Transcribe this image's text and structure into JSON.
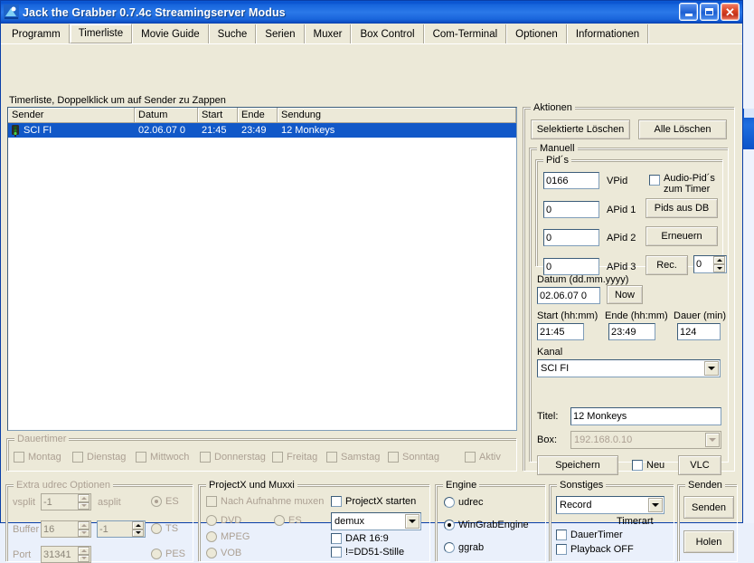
{
  "window": {
    "title": "Jack the Grabber 0.7.4c Streamingserver Modus",
    "icon": "app-icon",
    "buttons": {
      "minimize": "minimize",
      "maximize": "maximize",
      "close": "close"
    }
  },
  "tabs": [
    {
      "label": "Programm",
      "selected": false
    },
    {
      "label": "Timerliste",
      "selected": true
    },
    {
      "label": "Movie Guide",
      "selected": false
    },
    {
      "label": "Suche",
      "selected": false
    },
    {
      "label": "Serien",
      "selected": false
    },
    {
      "label": "Muxer",
      "selected": false
    },
    {
      "label": "Box Control",
      "selected": false
    },
    {
      "label": "Com-Terminal",
      "selected": false
    },
    {
      "label": "Optionen",
      "selected": false
    },
    {
      "label": "Informationen",
      "selected": false
    }
  ],
  "timerlist": {
    "hint": "Timerliste, Doppelklick um auf Sender zu Zappen",
    "columns": [
      "Sender",
      "Datum",
      "Start",
      "Ende",
      "Sendung"
    ],
    "rows": [
      {
        "icon": "traffic-light-icon",
        "sender": "SCI FI",
        "datum": "02.06.07 0",
        "start": "21:45",
        "ende": "23:49",
        "sendung": "12 Monkeys",
        "selected": true
      }
    ]
  },
  "dauertimer": {
    "caption": "Dauertimer",
    "days": [
      {
        "label": "Montag",
        "checked": false,
        "disabled": true
      },
      {
        "label": "Dienstag",
        "checked": false,
        "disabled": true
      },
      {
        "label": "Mittwoch",
        "checked": false,
        "disabled": true
      },
      {
        "label": "Donnerstag",
        "checked": false,
        "disabled": true
      },
      {
        "label": "Freitag",
        "checked": false,
        "disabled": true
      },
      {
        "label": "Samstag",
        "checked": false,
        "disabled": true
      },
      {
        "label": "Sonntag",
        "checked": false,
        "disabled": true
      }
    ],
    "aktiv": {
      "label": "Aktiv",
      "checked": false,
      "disabled": true
    }
  },
  "aktionen": {
    "caption": "Aktionen",
    "delete_selected": "Selektierte Löschen",
    "delete_all": "Alle Löschen",
    "manuell": {
      "caption": "Manuell",
      "pids": {
        "caption": "Pid´s",
        "vpid": {
          "label": "VPid",
          "value": "0166"
        },
        "apid1": {
          "label": "APid 1",
          "value": "0"
        },
        "apid2": {
          "label": "APid 2",
          "value": "0"
        },
        "apid3": {
          "label": "APid 3",
          "value": "0"
        },
        "audio_pids_checkbox": {
          "label_line1": "Audio-Pid´s",
          "label_line2": "zum Timer",
          "checked": false
        },
        "pids_from_db": "Pids aus DB",
        "renew": "Erneuern",
        "rec": "Rec.",
        "rec_count": "0"
      },
      "datum": {
        "label": "Datum (dd.mm.yyyy)",
        "value": "02.06.07 0",
        "now_button": "Now"
      },
      "start": {
        "label": "Start (hh:mm)",
        "value": "21:45"
      },
      "ende": {
        "label": "Ende (hh:mm)",
        "value": "23:49"
      },
      "dauer": {
        "label": "Dauer (min)",
        "value": "124"
      },
      "kanal": {
        "label": "Kanal",
        "value": "SCI FI"
      },
      "titel": {
        "label": "Titel:",
        "value": "12 Monkeys"
      },
      "box": {
        "label": "Box:",
        "value": "192.168.0.10",
        "disabled": true
      },
      "save_button": "Speichern",
      "neu_checkbox": {
        "label": "Neu",
        "checked": false
      },
      "vlc_button": "VLC"
    }
  },
  "extra_udrec": {
    "caption": "Extra udrec Optionen",
    "disabled": true,
    "vsplit": {
      "label": "vsplit",
      "value": "-1"
    },
    "buffer": {
      "label": "Buffer",
      "value": "16"
    },
    "port": {
      "label": "Port",
      "value": "31341"
    },
    "asplit": {
      "label": "asplit",
      "value": "-1"
    },
    "radios": [
      {
        "label": "ES",
        "checked": true
      },
      {
        "label": "TS",
        "checked": false
      },
      {
        "label": "PES",
        "checked": false
      }
    ]
  },
  "projectx": {
    "caption": "ProjectX und Muxxi",
    "mux_after_record": {
      "label": "Nach Aufnahme muxen",
      "checked": false,
      "disabled": true
    },
    "format_radios": [
      {
        "label": "DVD",
        "checked": false,
        "disabled": true
      },
      {
        "label": "MPEG",
        "checked": false,
        "disabled": true
      },
      {
        "label": "VOB",
        "checked": false,
        "disabled": true
      }
    ],
    "es_radio": {
      "label": "ES",
      "checked": false,
      "disabled": true
    },
    "start_projectx": {
      "label": "ProjectX starten",
      "checked": false
    },
    "mode_combo": {
      "value": "demux"
    },
    "dar_checkbox": {
      "label": "DAR 16:9",
      "checked": false
    },
    "dd51_checkbox": {
      "label": "!=DD51-Stille",
      "checked": false
    }
  },
  "engine": {
    "caption": "Engine",
    "options": [
      {
        "label": "udrec",
        "checked": false
      },
      {
        "label": "WinGrabEngine",
        "checked": true
      },
      {
        "label": "ggrab",
        "checked": false
      }
    ]
  },
  "sonstiges": {
    "caption": "Sonstiges",
    "timerart_combo": {
      "value": "Record"
    },
    "timerart_label": "Timerart",
    "dauertimer_checkbox": {
      "label": "DauerTimer",
      "checked": false
    },
    "playback_off_checkbox": {
      "label": "Playback OFF",
      "checked": false
    }
  },
  "senden": {
    "caption": "Senden",
    "send_button": "Senden",
    "fetch_button": "Holen"
  },
  "colors": {
    "title_bar_blue": "#0a53cf",
    "selection_blue": "#1158c8",
    "face": "#ece9d8",
    "disabled_text": "#aca093"
  }
}
